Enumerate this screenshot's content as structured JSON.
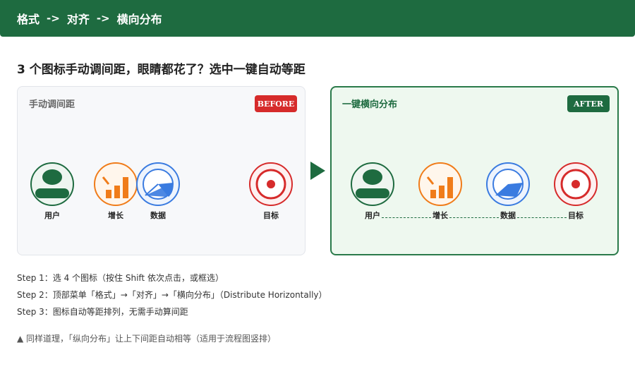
{
  "header": {
    "crumbs": [
      "格式",
      "对齐",
      "横向分布"
    ],
    "separator": "->"
  },
  "headline": "3 个图标手动调间距，眼睛都花了？选中一键自动等距",
  "before": {
    "title": "手动调间距",
    "badge": "BEFORE",
    "icons": [
      {
        "label": "用户",
        "icon": "user-icon"
      },
      {
        "label": "增长",
        "icon": "growth-chart-icon"
      },
      {
        "label": "数据",
        "icon": "pie-data-icon"
      },
      {
        "label": "目标",
        "icon": "target-icon"
      }
    ]
  },
  "after": {
    "title": "一键横向分布",
    "badge": "AFTER",
    "icons": [
      {
        "label": "用户",
        "icon": "user-icon"
      },
      {
        "label": "增长",
        "icon": "growth-chart-icon"
      },
      {
        "label": "数据",
        "icon": "pie-data-icon"
      },
      {
        "label": "目标",
        "icon": "target-icon"
      }
    ]
  },
  "steps": [
    "Step 1：选 4 个图标（按住 Shift 依次点击，或框选）",
    "Step 2：顶部菜单「格式」→「对齐」→「横向分布」（Distribute Horizontally）",
    "Step 3：图标自动等距排列，无需手动算间距"
  ],
  "note": "▲ 同样道理，「纵向分布」让上下间距自动相等（适用于流程图竖排）",
  "colors": {
    "brand_green": "#1e6b40",
    "user": "#1e6b40",
    "growth": "#f07c1a",
    "data": "#3a7be0",
    "target": "#d62b2b",
    "before_badge": "#d62b2b"
  }
}
